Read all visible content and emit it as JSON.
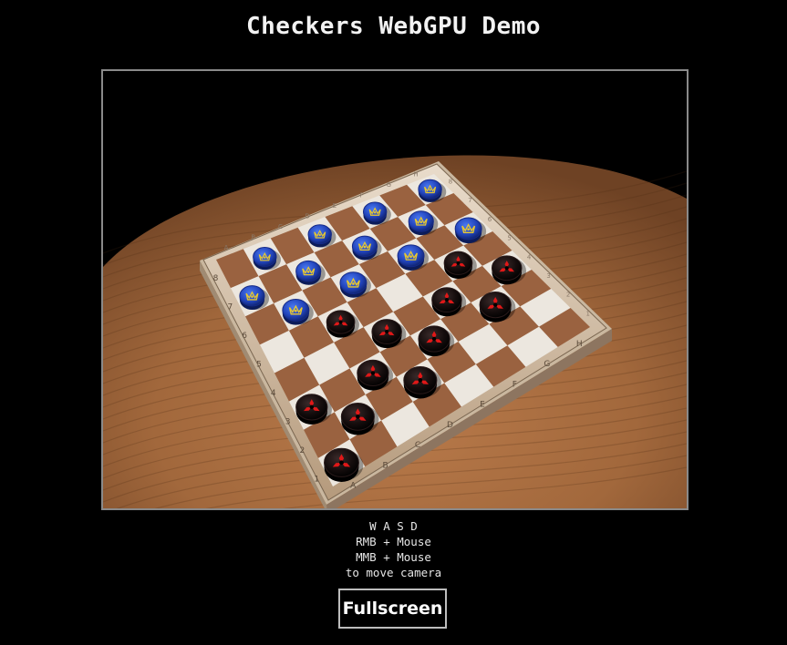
{
  "page": {
    "title": "Checkers WebGPU Demo"
  },
  "scene": {
    "board_files": [
      "A",
      "B",
      "C",
      "D",
      "E",
      "F",
      "G",
      "H"
    ],
    "board_ranks": [
      "1",
      "2",
      "3",
      "4",
      "5",
      "6",
      "7",
      "8"
    ],
    "colors": {
      "table_wood": "#a86a3e",
      "light_square": "#ece7df",
      "dark_square": "#9a6240",
      "blue_piece": "#2448c8",
      "red_piece": "#111111",
      "red_emblem": "#e01818",
      "gold_emblem": "#e8c830"
    },
    "pieces": [
      {
        "color": "blue",
        "icon": "gold-crown-emblem-icon",
        "square": "a7"
      },
      {
        "color": "blue",
        "icon": "gold-crown-emblem-icon",
        "square": "b8"
      },
      {
        "color": "blue",
        "icon": "gold-crown-emblem-icon",
        "square": "b6"
      },
      {
        "color": "blue",
        "icon": "gold-crown-emblem-icon",
        "square": "c7"
      },
      {
        "color": "blue",
        "icon": "gold-crown-emblem-icon",
        "square": "d8"
      },
      {
        "color": "blue",
        "icon": "gold-crown-emblem-icon",
        "square": "d6"
      },
      {
        "color": "blue",
        "icon": "gold-crown-emblem-icon",
        "square": "e7"
      },
      {
        "color": "blue",
        "icon": "gold-crown-emblem-icon",
        "square": "f8"
      },
      {
        "color": "blue",
        "icon": "gold-crown-emblem-icon",
        "square": "f6"
      },
      {
        "color": "blue",
        "icon": "gold-crown-emblem-icon",
        "square": "g7"
      },
      {
        "color": "blue",
        "icon": "gold-crown-emblem-icon",
        "square": "h8"
      },
      {
        "color": "blue",
        "icon": "gold-crown-emblem-icon",
        "square": "h6"
      },
      {
        "color": "red",
        "icon": "red-tri-blade-emblem-icon",
        "square": "a1"
      },
      {
        "color": "red",
        "icon": "red-tri-blade-emblem-icon",
        "square": "a3"
      },
      {
        "color": "red",
        "icon": "red-tri-blade-emblem-icon",
        "square": "b2"
      },
      {
        "color": "red",
        "icon": "red-tri-blade-emblem-icon",
        "square": "c3"
      },
      {
        "color": "red",
        "icon": "red-tri-blade-emblem-icon",
        "square": "c5"
      },
      {
        "color": "red",
        "icon": "red-tri-blade-emblem-icon",
        "square": "d2"
      },
      {
        "color": "red",
        "icon": "red-tri-blade-emblem-icon",
        "square": "d4"
      },
      {
        "color": "red",
        "icon": "red-tri-blade-emblem-icon",
        "square": "e3"
      },
      {
        "color": "red",
        "icon": "red-tri-blade-emblem-icon",
        "square": "f4"
      },
      {
        "color": "red",
        "icon": "red-tri-blade-emblem-icon",
        "square": "g3"
      },
      {
        "color": "red",
        "icon": "red-tri-blade-emblem-icon",
        "square": "g5"
      },
      {
        "color": "red",
        "icon": "red-tri-blade-emblem-icon",
        "square": "h4"
      }
    ]
  },
  "help": {
    "line1": "W A S D",
    "line2": "RMB + Mouse",
    "line3": "MMB + Mouse",
    "line4": "to move camera"
  },
  "buttons": {
    "fullscreen_label": "Fullscreen"
  }
}
